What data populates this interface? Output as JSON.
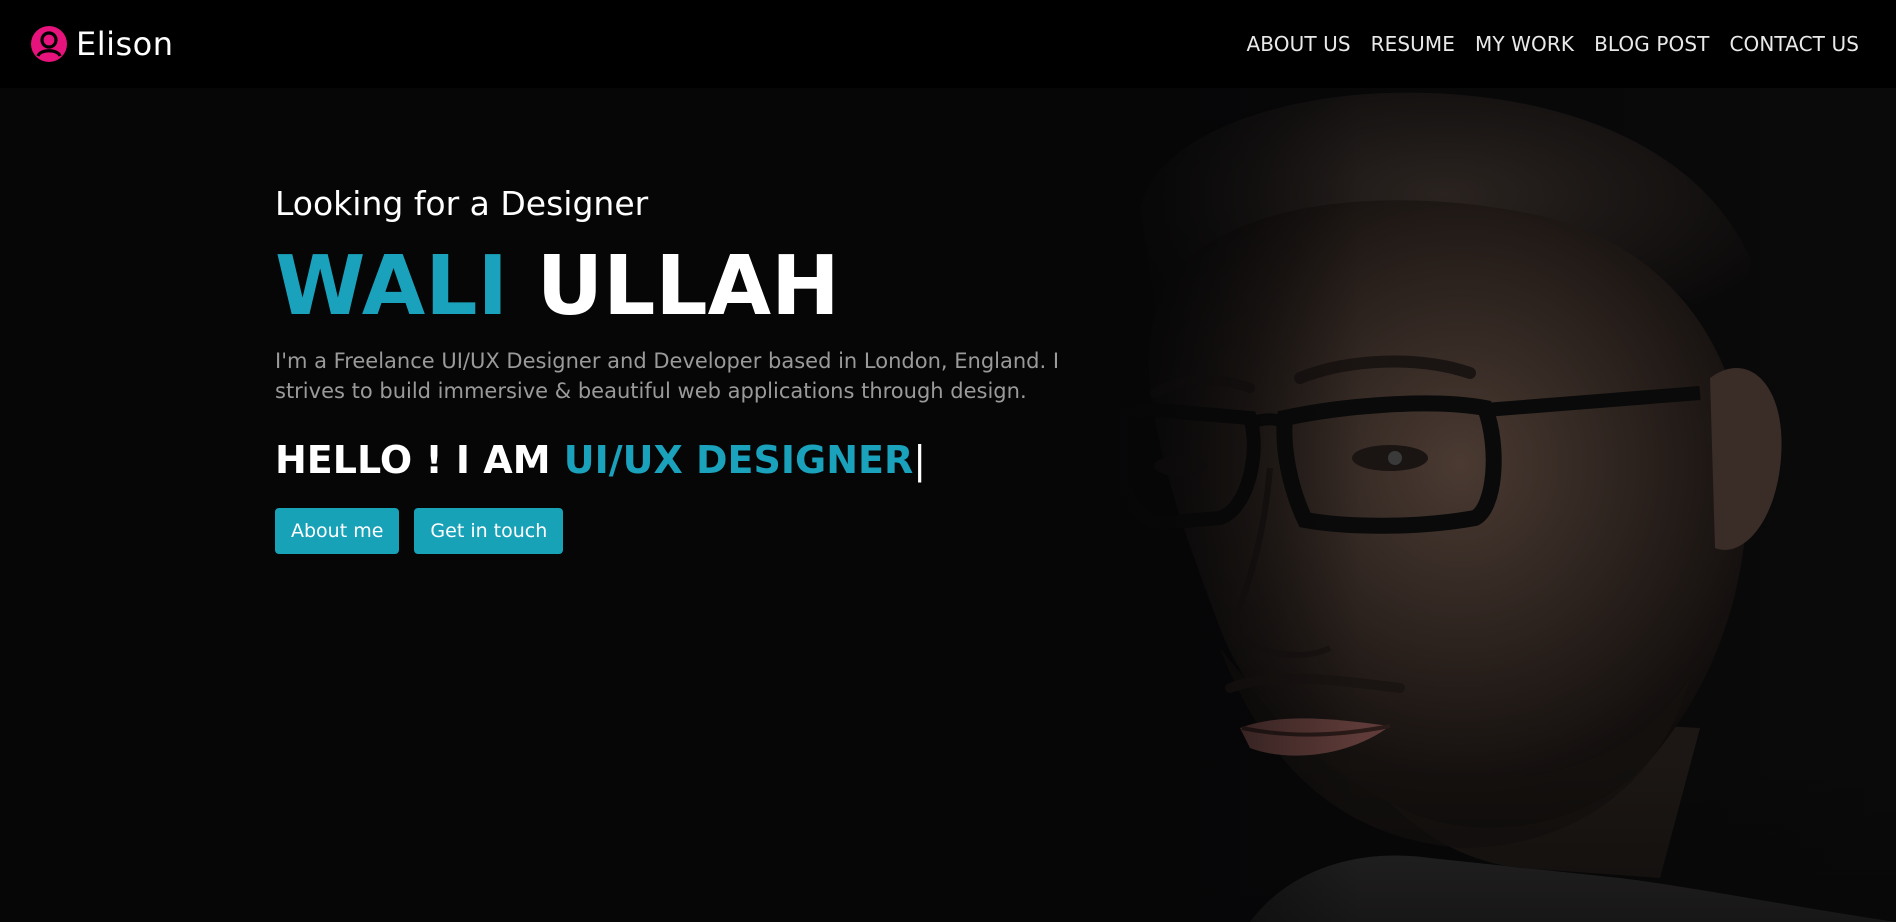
{
  "navbar": {
    "brand_name": "Elison",
    "brand_icon": "user-circle-icon",
    "brand_color": "#e5137b",
    "links": [
      "ABOUT US",
      "RESUME",
      "MY WORK",
      "BLOG POST",
      "CONTACT US"
    ]
  },
  "hero": {
    "tagline": "Looking for a Designer",
    "name_first": "WALI",
    "name_last": "ULLAH",
    "intro": "I'm a Freelance UI/UX Designer and Developer based in London, England. I strives to build immersive & beautiful web applications through design.",
    "typed_prefix": "HELLO ! I AM ",
    "typed_role": "UI/UX DESIGNER",
    "typed_cursor": "|",
    "buttons": [
      "About me",
      "Get in touch"
    ],
    "accent_color": "#1aa2bc",
    "button_color": "#17a2b8"
  }
}
